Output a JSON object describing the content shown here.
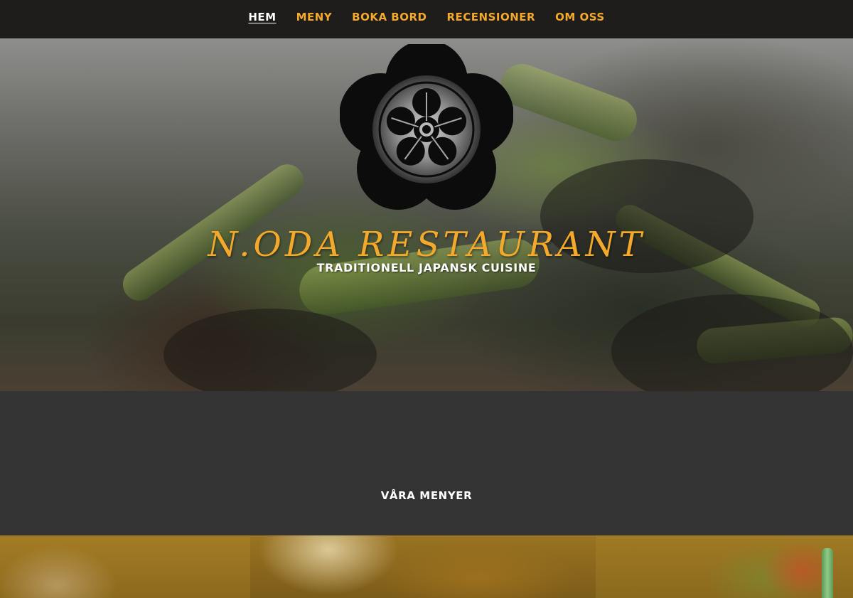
{
  "nav": {
    "items": [
      {
        "label": "HEM",
        "active": true
      },
      {
        "label": "MENY",
        "active": false
      },
      {
        "label": "BOKA BORD",
        "active": false
      },
      {
        "label": "RECENSIONER",
        "active": false
      },
      {
        "label": "OM OSS",
        "active": false
      }
    ]
  },
  "hero": {
    "logo_icon": "oda-mon-crest-icon",
    "title": "N.ODA RESTAURANT",
    "subtitle": "TRADITIONELL JAPANSK CUISINE"
  },
  "menus": {
    "heading": "VÅRA MENYER"
  },
  "colors": {
    "accent": "#f4a92a",
    "nav_bg": "#1e1d1b",
    "section_bg": "#333333",
    "text_light": "#ffffff"
  }
}
